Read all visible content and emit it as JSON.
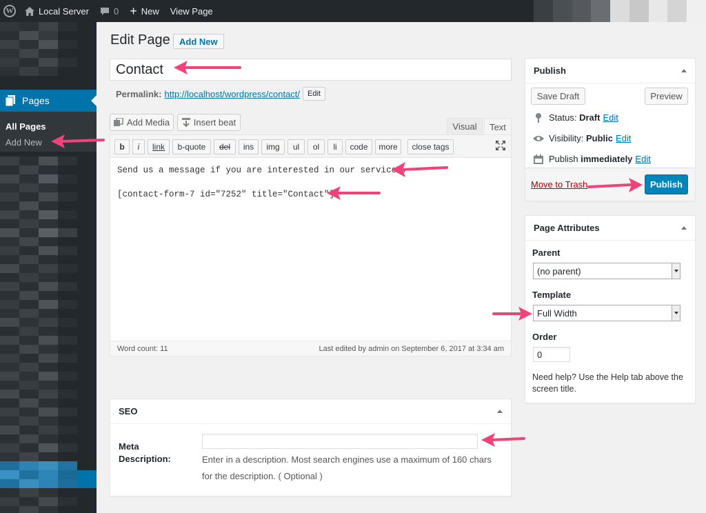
{
  "admin_bar": {
    "site_name": "Local Server",
    "comments_count": "0",
    "new_label": "New",
    "view_page_label": "View Page",
    "icons": [
      "wordpress-logo-icon",
      "home-icon",
      "comment-icon",
      "plus-icon"
    ]
  },
  "sidebar": {
    "pages_label": "Pages",
    "sub_items": [
      {
        "label": "All Pages",
        "current": true
      },
      {
        "label": "Add New",
        "current": false
      }
    ],
    "active_color": "#0073aa"
  },
  "header": {
    "title": "Edit Page",
    "add_new_label": "Add New"
  },
  "post": {
    "title": "Contact",
    "permalink_label": "Permalink:",
    "permalink_url": "http://localhost/wordpress/contact/",
    "permalink_edit_label": "Edit"
  },
  "editor": {
    "add_media_label": "Add Media",
    "insert_beat_label": "Insert beat",
    "tab_visual": "Visual",
    "tab_text": "Text",
    "quicktags": [
      "b",
      "i",
      "link",
      "b-quote",
      "del",
      "ins",
      "img",
      "ul",
      "ol",
      "li",
      "code",
      "more",
      "close tags"
    ],
    "content_line1": "Send us a message if you are interested in our services.",
    "content_line2": "[contact-form-7 id=\"7252\" title=\"Contact\"]",
    "word_count": "Word count: 11",
    "last_edited": "Last edited by admin on September 6, 2017 at 3:34 am"
  },
  "seo": {
    "title": "SEO",
    "meta_label": "Meta Description:",
    "meta_value": "",
    "help": "Enter in a description. Most search engines use a maximum of 160 chars for the description. ( Optional )"
  },
  "publish": {
    "title": "Publish",
    "save_draft_label": "Save Draft",
    "preview_label": "Preview",
    "status_label": "Status:",
    "status_value": "Draft",
    "visibility_label": "Visibility:",
    "visibility_value": "Public",
    "publish_label": "Publish",
    "publish_when": "immediately",
    "edit_label": "Edit",
    "trash_label": "Move to Trash",
    "publish_button_label": "Publish",
    "button_color": "#0085ba"
  },
  "page_attributes": {
    "title": "Page Attributes",
    "parent_label": "Parent",
    "parent_value": "(no parent)",
    "template_label": "Template",
    "template_value": "Full Width",
    "order_label": "Order",
    "order_value": "0",
    "help_text": "Need help? Use the Help tab above the screen title."
  },
  "annotation_color": "#f0437a"
}
